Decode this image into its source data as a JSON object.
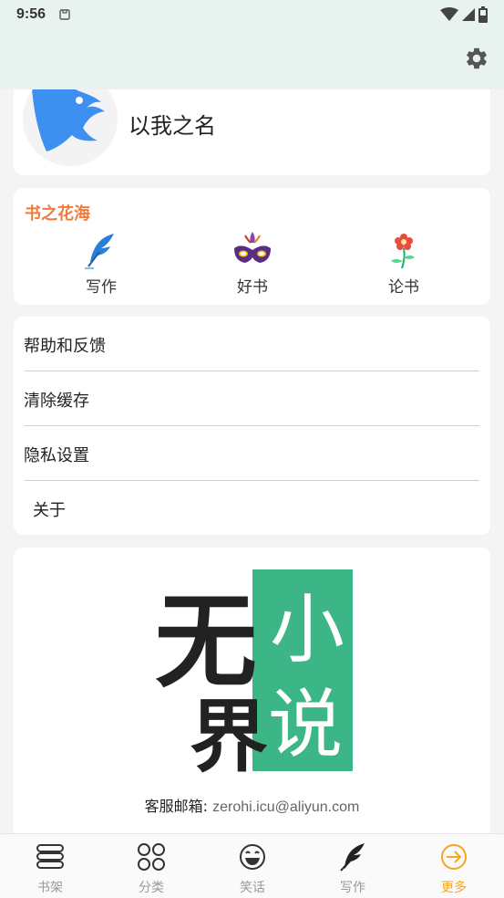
{
  "status_bar": {
    "time": "9:56",
    "icons": [
      "clipboard-icon",
      "wifi-icon",
      "signal-icon",
      "battery-icon"
    ]
  },
  "app_bar": {
    "settings_icon": "gear-icon"
  },
  "profile": {
    "username": "以我之名",
    "avatar_color": "#3d8ff0"
  },
  "flower_section": {
    "title": "书之花海",
    "title_color": "#f07b3c",
    "items": [
      {
        "label": "写作",
        "icon": "quill-icon"
      },
      {
        "label": "好书",
        "icon": "mask-icon"
      },
      {
        "label": "论书",
        "icon": "flower-icon"
      }
    ]
  },
  "menu": {
    "items": [
      {
        "label": "帮助和反馈"
      },
      {
        "label": "清除缓存"
      },
      {
        "label": "隐私设置"
      },
      {
        "label": "关于"
      }
    ]
  },
  "logo": {
    "char_wu": "无",
    "char_jie": "界",
    "char_xiao": "小",
    "char_shuo": "说",
    "green": "#3cb587"
  },
  "contact": {
    "email_label": "客服邮箱:",
    "email_value": "zerohi.icu@aliyun.com"
  },
  "bottom_nav": {
    "active_color": "#f5a623",
    "items": [
      {
        "label": "书架",
        "icon": "bookshelf-icon"
      },
      {
        "label": "分类",
        "icon": "category-icon"
      },
      {
        "label": "笑话",
        "icon": "smile-icon"
      },
      {
        "label": "写作",
        "icon": "quill-icon"
      },
      {
        "label": "更多",
        "icon": "arrow-circle-icon"
      }
    ]
  }
}
